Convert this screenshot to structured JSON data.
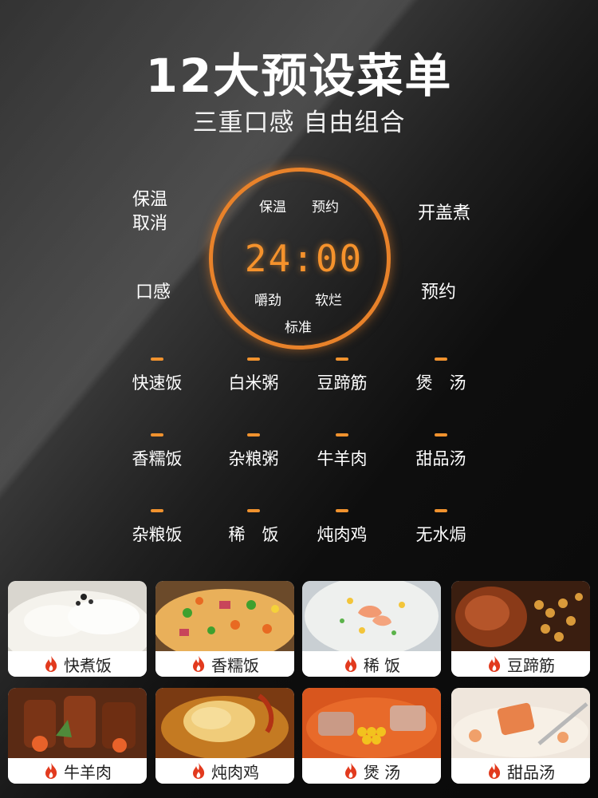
{
  "header": {
    "title": "12大预设菜单",
    "subtitle": "三重口感 自由组合"
  },
  "control_panel": {
    "left_buttons": {
      "warm_cancel_line1": "保温",
      "warm_cancel_line2": "取消",
      "texture": "口感"
    },
    "right_buttons": {
      "open_lid": "开盖煮",
      "schedule": "预约"
    },
    "dial": {
      "top_left": "保温",
      "top_right": "预约",
      "time": "24:00",
      "bottom_left": "嚼劲",
      "bottom_right": "软烂",
      "bottom_center": "标准",
      "accent_color": "#e8822a"
    },
    "menu": [
      [
        "快速饭",
        "白米粥",
        "豆蹄筋",
        "煲　汤"
      ],
      [
        "香糯饭",
        "杂粮粥",
        "牛羊肉",
        "甜品汤"
      ],
      [
        "杂粮饭",
        "稀　饭",
        "炖肉鸡",
        "无水焗"
      ]
    ]
  },
  "gallery": {
    "row1": [
      "快煮饭",
      "香糯饭",
      "稀 饭",
      "豆蹄筋"
    ],
    "row2": [
      "牛羊肉",
      "炖肉鸡",
      "煲 汤",
      "甜品汤"
    ],
    "flame_color": "#e23a1e"
  }
}
